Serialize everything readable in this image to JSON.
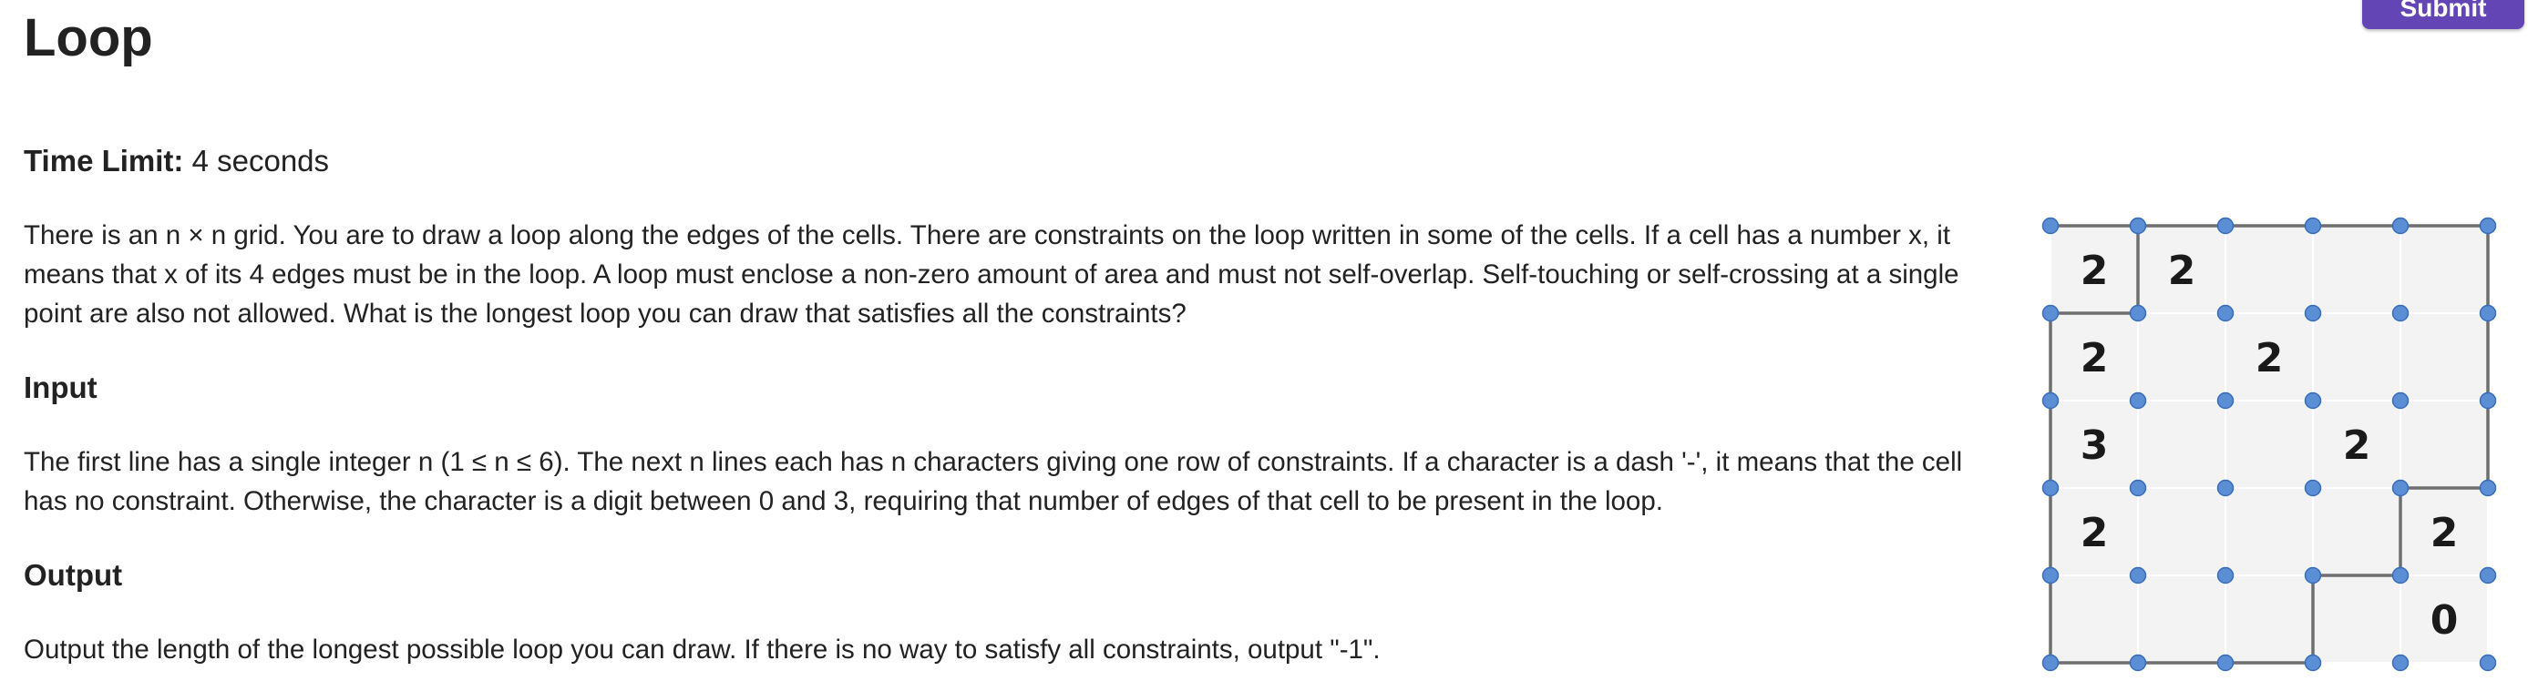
{
  "header": {
    "title": "Loop",
    "submit_label": "Submit"
  },
  "time_limit": {
    "label": "Time Limit:",
    "value": "4 seconds"
  },
  "statement": {
    "p1": "There is an n × n grid. You are to draw a loop along the edges of the cells. There are constraints on the loop written in some of the cells. If a cell has a number x, it means that x of its 4 edges must be in the loop. A loop must enclose a non-zero amount of area and must not self-overlap. Self-touching or self-crossing at a single point are also not allowed. What is the longest loop you can draw that satisfies all the constraints?"
  },
  "input_section": {
    "heading": "Input",
    "text": "The first line has a single integer n (1 ≤ n ≤ 6). The next n lines each has n characters giving one row of constraints. If a character is a dash '-', it means that the cell has no constraint. Otherwise, the character is a digit between 0 and 3, requiring that number of edges of that cell to be present in the loop."
  },
  "output_section": {
    "heading": "Output",
    "text": "Output the length of the longest possible loop you can draw. If there is no way to satisfy all constraints, output \"-1\"."
  },
  "figure": {
    "size": 5,
    "constraints": [
      [
        "2",
        "2",
        "-",
        "-",
        "-"
      ],
      [
        "2",
        "-",
        "2",
        "-",
        "-"
      ],
      [
        "3",
        "-",
        "-",
        "2",
        "-"
      ],
      [
        "2",
        "-",
        "-",
        "-",
        "2"
      ],
      [
        "-",
        "-",
        "-",
        "-",
        "0"
      ]
    ],
    "loop_vertices": [
      [
        0,
        0
      ],
      [
        1,
        0
      ],
      [
        1,
        1
      ],
      [
        0,
        1
      ],
      [
        0,
        2
      ],
      [
        0,
        3
      ],
      [
        0,
        4
      ],
      [
        0,
        5
      ],
      [
        1,
        5
      ],
      [
        2,
        5
      ],
      [
        3,
        5
      ],
      [
        3,
        4
      ],
      [
        4,
        4
      ],
      [
        4,
        3
      ],
      [
        5,
        3
      ],
      [
        5,
        2
      ],
      [
        5,
        1
      ],
      [
        5,
        0
      ],
      [
        4,
        0
      ],
      [
        3,
        0
      ],
      [
        2,
        0
      ]
    ],
    "colors": {
      "cell_fill": "#f3f3f3",
      "grid_line": "#ffffff",
      "loop_line": "#6e6e6e",
      "dot_fill": "#5a8fd6",
      "dot_stroke": "#3a6db8"
    }
  }
}
